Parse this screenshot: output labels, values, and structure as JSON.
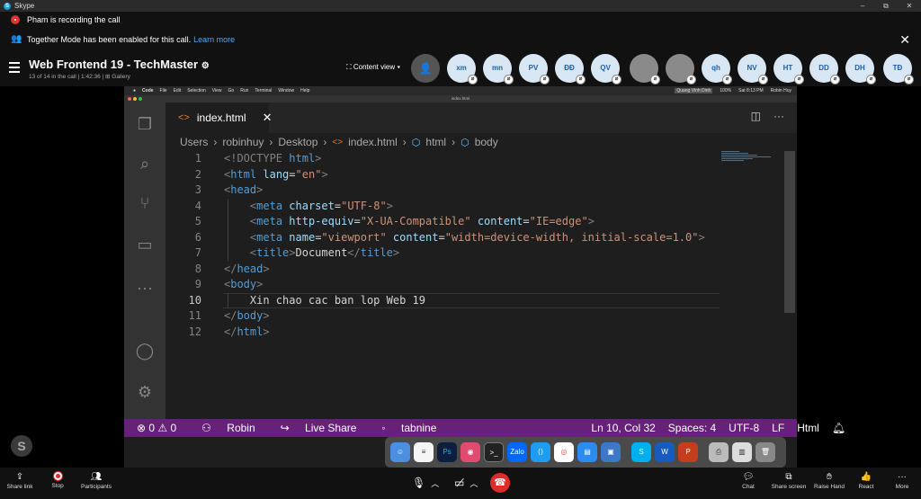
{
  "window": {
    "app_title": "Skype",
    "minimize": "–",
    "restore": "⧉",
    "close": "✕"
  },
  "banners": {
    "recording": "Pham is recording the call",
    "together_mode": "Together Mode has been enabled for this call.",
    "learn_more": "Learn more"
  },
  "call": {
    "title": "Web Frontend 19 - TechMaster",
    "subtitle": "13 of 14 in the call | 1:42:36 | ⊞ Gallery",
    "content_view": "Content view",
    "participants": [
      {
        "initials": "xm"
      },
      {
        "initials": "mn"
      },
      {
        "initials": "PV"
      },
      {
        "initials": "ĐĐ"
      },
      {
        "initials": "QV"
      },
      {
        "initials": ""
      },
      {
        "initials": ""
      },
      {
        "initials": "qh"
      },
      {
        "initials": "NV"
      },
      {
        "initials": "HT"
      },
      {
        "initials": "DD"
      },
      {
        "initials": "DH"
      },
      {
        "initials": "TĐ"
      }
    ]
  },
  "shared_screen": {
    "mac_menu": [
      "Code",
      "File",
      "Edit",
      "Selection",
      "View",
      "Go",
      "Run",
      "Terminal",
      "Window",
      "Help"
    ],
    "mac_status": {
      "name_tag": "Quang Vinh Dinh",
      "battery": "100%",
      "clock": "Sat 8:13 PM",
      "user": "Robin Huy"
    },
    "window_title": "index.html",
    "tab_name": "index.html",
    "breadcrumb": [
      "Users",
      "robinhuy",
      "Desktop",
      "index.html",
      "html",
      "body"
    ],
    "line_numbers": [
      "1",
      "2",
      "3",
      "4",
      "5",
      "6",
      "7",
      "8",
      "9",
      "10",
      "11",
      "12"
    ],
    "code": {
      "l1a": "<!DOCTYPE ",
      "l1b": "html",
      "l1c": ">",
      "l2_attr": "lang",
      "l2_val": "\"en\"",
      "l4_attr": "charset",
      "l4_val": "\"UTF-8\"",
      "l5_attr1": "http-equiv",
      "l5_val1": "\"X-UA-Compatible\"",
      "l5_attr2": "content",
      "l5_val2": "\"IE=edge\"",
      "l6_attr1": "name",
      "l6_val1": "\"viewport\"",
      "l6_attr2": "content",
      "l6_val2": "\"width=device-width, initial-scale=1.0\"",
      "l7_text": "Document",
      "l10_text": "Xin chao cac ban lop Web 19"
    },
    "status_bar": {
      "errors": "⊗ 0 ⚠ 0",
      "user": "Robin",
      "live_share": "Live Share",
      "tabnine": "tabnine",
      "position": "Ln 10, Col 32",
      "spaces": "Spaces: 4",
      "encoding": "UTF-8",
      "eol": "LF",
      "language": "Html"
    }
  },
  "bottom_bar": {
    "share_link": "Share link",
    "stop": "Stop",
    "participants": "Participants",
    "chat": "Chat",
    "share_screen": "Share screen",
    "raise_hand": "Raise Hand",
    "react": "React",
    "more": "More"
  },
  "colors": {
    "accent": "#68217a",
    "hangup": "#e02b2b",
    "record": "#e02b2b"
  }
}
